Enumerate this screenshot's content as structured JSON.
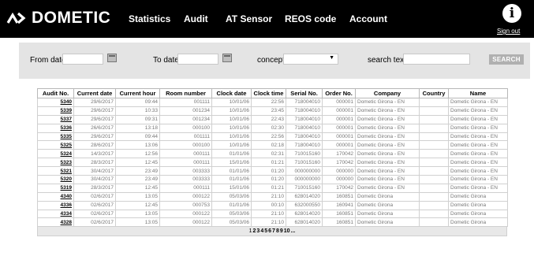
{
  "brand": {
    "name": "DOMETIC"
  },
  "nav": {
    "items": [
      "Statistics",
      "Audit",
      "AT Sensor",
      "REOS code",
      "Account"
    ]
  },
  "user": {
    "signout_label": "Sign out",
    "info_glyph": "i"
  },
  "filters": {
    "from_date_label": "From date",
    "to_date_label": "To date",
    "concept_label": "concept",
    "search_text_label": "search text",
    "search_button": "SEARCH",
    "from_date_value": "",
    "to_date_value": "",
    "concept_value": "",
    "search_text_value": ""
  },
  "table": {
    "headers": [
      "Audit No.",
      "Current date",
      "Current hour",
      "Room number",
      "Clock date",
      "Clock time",
      "Serial No.",
      "Order No.",
      "Company",
      "Country",
      "Name"
    ],
    "rows": [
      [
        "5340",
        "29/6/2017",
        "09:44",
        "001111",
        "10/01/06",
        "22:56",
        "718004010",
        "000001",
        "Dometic Girona - EN",
        "",
        "Dometic Girona - EN"
      ],
      [
        "5339",
        "29/6/2017",
        "10:33",
        "001234",
        "10/01/06",
        "23:45",
        "718004010",
        "000001",
        "Dometic Girona - EN",
        "",
        "Dometic Girona - EN"
      ],
      [
        "5337",
        "29/6/2017",
        "09:31",
        "001234",
        "10/01/06",
        "22:43",
        "718004010",
        "000001",
        "Dometic Girona - EN",
        "",
        "Dometic Girona - EN"
      ],
      [
        "5336",
        "26/6/2017",
        "13:18",
        "000100",
        "10/01/06",
        "02:30",
        "718004010",
        "000001",
        "Dometic Girona - EN",
        "",
        "Dometic Girona - EN"
      ],
      [
        "5335",
        "29/6/2017",
        "09:44",
        "001111",
        "10/01/06",
        "22:56",
        "718004010",
        "000001",
        "Dometic Girona - EN",
        "",
        "Dometic Girona - EN"
      ],
      [
        "5325",
        "28/6/2017",
        "13:06",
        "000100",
        "10/01/06",
        "02:18",
        "718004010",
        "000001",
        "Dometic Girona - EN",
        "",
        "Dometic Girona - EN"
      ],
      [
        "5324",
        "14/3/2017",
        "12:56",
        "000111",
        "01/01/06",
        "02:31",
        "710015160",
        "170042",
        "Dometic Girona - EN",
        "",
        "Dometic Girona - EN"
      ],
      [
        "5323",
        "28/3/2017",
        "12:45",
        "000111",
        "15/01/06",
        "01:21",
        "710015160",
        "170042",
        "Dometic Girona - EN",
        "",
        "Dometic Girona - EN"
      ],
      [
        "5321",
        "30/4/2017",
        "23:49",
        "003333",
        "01/01/06",
        "01:20",
        "000000000",
        "000000",
        "Dometic Girona - EN",
        "",
        "Dometic Girona - EN"
      ],
      [
        "5320",
        "30/4/2017",
        "23:49",
        "003333",
        "01/01/06",
        "01:20",
        "000000000",
        "000000",
        "Dometic Girona - EN",
        "",
        "Dometic Girona - EN"
      ],
      [
        "5319",
        "28/3/2017",
        "12:45",
        "000111",
        "15/01/06",
        "01:21",
        "710015160",
        "170042",
        "Dometic Girona - EN",
        "",
        "Dometic Girona - EN"
      ],
      [
        "4340",
        "02/6/2017",
        "13:05",
        "000122",
        "05/03/06",
        "21:10",
        "628014020",
        "160851",
        "Dometic Girona",
        "",
        "Dometic Girona"
      ],
      [
        "4336",
        "02/6/2017",
        "12:45",
        "000753",
        "01/01/06",
        "00:10",
        "632000550",
        "160941",
        "Dometic Girona",
        "",
        "Dometic Girona"
      ],
      [
        "4334",
        "02/6/2017",
        "13:05",
        "000122",
        "05/03/06",
        "21:10",
        "628014020",
        "160851",
        "Dometic Girona",
        "",
        "Dometic Girona"
      ],
      [
        "4328",
        "02/6/2017",
        "13:05",
        "000122",
        "05/03/06",
        "21:10",
        "628014020",
        "160851",
        "Dometic Girona",
        "",
        "Dometic Girona"
      ]
    ]
  },
  "pager": {
    "pages": [
      "1",
      "2",
      "3",
      "4",
      "5",
      "6",
      "7",
      "8",
      "9",
      "10",
      "..."
    ],
    "current": "1"
  },
  "colors": {
    "header_bg": "#000000",
    "filter_bg": "#e4e4e4",
    "button_bg": "#b0b0b0",
    "pager_bg": "#e8e8e8"
  }
}
